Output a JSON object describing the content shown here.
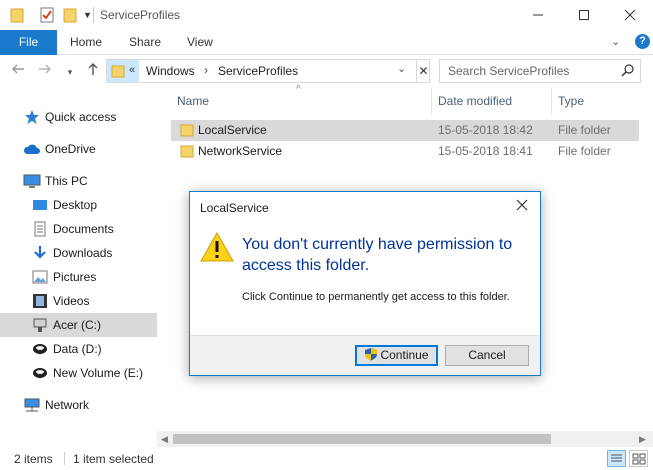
{
  "window": {
    "title": "ServiceProfiles",
    "minimize_icon": "minimize-icon",
    "maximize_icon": "maximize-icon",
    "close_icon": "close-icon"
  },
  "ribbon": {
    "tabs": [
      {
        "label": "File"
      },
      {
        "label": "Home"
      },
      {
        "label": "Share"
      },
      {
        "label": "View"
      }
    ],
    "file_tab_color": "#1979ca"
  },
  "address_bar": {
    "overflow_glyph": "«",
    "breadcrumbs": [
      "Windows",
      "ServiceProfiles"
    ],
    "highlight_color": "#cce8ff"
  },
  "search": {
    "placeholder": "Search ServiceProfiles"
  },
  "sidebar": {
    "items": [
      {
        "label": "Quick access",
        "icon": "star-icon"
      },
      {
        "label": "OneDrive",
        "icon": "cloud-icon"
      },
      {
        "label": "This PC",
        "icon": "computer-icon"
      },
      {
        "label": "Desktop",
        "icon": "desktop-icon"
      },
      {
        "label": "Documents",
        "icon": "documents-icon"
      },
      {
        "label": "Downloads",
        "icon": "download-arrow-icon"
      },
      {
        "label": "Pictures",
        "icon": "pictures-icon"
      },
      {
        "label": "Videos",
        "icon": "film-icon"
      },
      {
        "label": "Acer (C:)",
        "icon": "drive-icon",
        "selected": true
      },
      {
        "label": "Data (D:)",
        "icon": "drive-icon"
      },
      {
        "label": "New Volume (E:)",
        "icon": "drive-icon"
      },
      {
        "label": "Network",
        "icon": "network-icon"
      }
    ]
  },
  "file_list": {
    "columns": [
      "Name",
      "Date modified",
      "Type"
    ],
    "rows": [
      {
        "name": "LocalService",
        "date": "15-05-2018 18:42",
        "type": "File folder",
        "selected": true
      },
      {
        "name": "NetworkService",
        "date": "15-05-2018 18:41",
        "type": "File folder",
        "selected": false
      }
    ]
  },
  "status_bar": {
    "item_count": "2 items",
    "selection": "1 item selected"
  },
  "dialog": {
    "title": "LocalService",
    "main_instruction": "You don't currently have permission to access this folder.",
    "content": "Click Continue to permanently get access to this folder.",
    "continue_label": "Continue",
    "cancel_label": "Cancel",
    "main_text_color": "#003399"
  }
}
